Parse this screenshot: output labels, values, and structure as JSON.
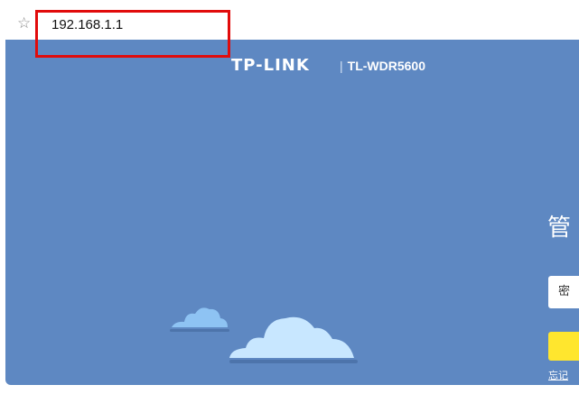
{
  "browser": {
    "address_url": "192.168.1.1",
    "bookmark_icon": "star-icon"
  },
  "header": {
    "brand": "TP-LINK",
    "separator": "|",
    "model": "TL-WDR5600"
  },
  "login": {
    "title_partial": "管",
    "password_label_partial": "密",
    "forgot_link_partial": "忘记"
  },
  "colors": {
    "page_background": "#5e88c2",
    "highlight_border": "#e10b0b",
    "login_button": "#ffe62e",
    "cloud_light": "#c8e7ff",
    "cloud_mid": "#8ec3f3"
  }
}
